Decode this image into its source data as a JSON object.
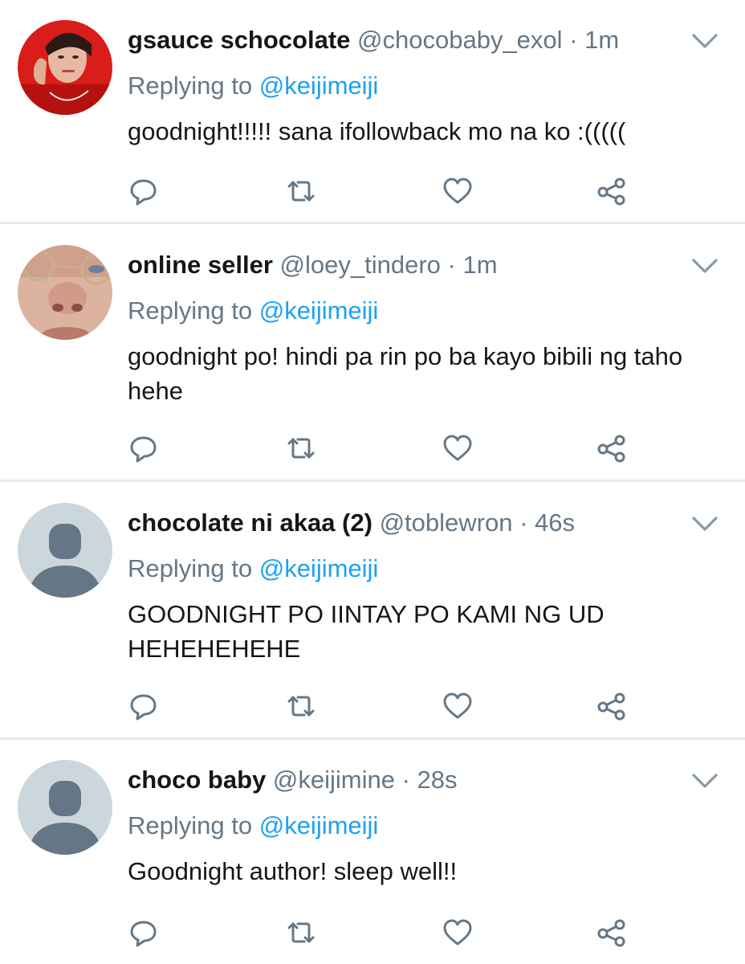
{
  "tweets": [
    {
      "name": "gsauce schocolate",
      "handle": "@chocobaby_exol",
      "dot": "·",
      "time": "1m",
      "replying_prefix": "Replying to ",
      "replying_to": "@keijimeiji",
      "text": "goodnight!!!!! sana ifollowback mo na ko :(((((",
      "avatar": "photo-red-icon"
    },
    {
      "name": "online seller",
      "handle": "@loey_tindero",
      "dot": "·",
      "time": "1m",
      "replying_prefix": "Replying to ",
      "replying_to": "@keijimeiji",
      "text": "goodnight po! hindi pa rin po ba kayo bibili ng taho hehe",
      "avatar": "photo-face-icon"
    },
    {
      "name": "chocolate ni akaa (2)",
      "handle": "@toblewron",
      "dot": "·",
      "time": "46s",
      "replying_prefix": "Replying to ",
      "replying_to": "@keijimeiji",
      "text": "GOODNIGHT PO IINTAY PO KAMI NG UD HEHEHEHEHE",
      "avatar": "default-avatar-icon"
    },
    {
      "name": "choco baby",
      "handle": "@keijimine",
      "dot": "·",
      "time": "28s",
      "replying_prefix": "Replying to ",
      "replying_to": "@keijimeiji",
      "text": "Goodnight author! sleep well!!",
      "avatar": "default-avatar-icon"
    }
  ],
  "colors": {
    "text": "#14171a",
    "secondary": "#657786",
    "link": "#1da1f2",
    "divider": "#e6ecf0",
    "icon": "#657786",
    "default_avatar_bg": "#ccd6dd",
    "default_avatar_fg": "#657786"
  },
  "icons": [
    "reply-icon",
    "retweet-icon",
    "like-icon",
    "share-icon",
    "chevron-down-icon"
  ]
}
